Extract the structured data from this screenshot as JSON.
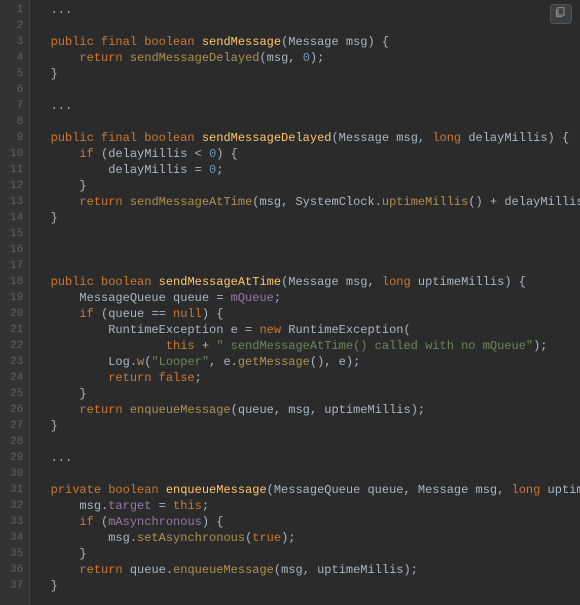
{
  "gutter": {
    "start": 1,
    "end": 37
  },
  "copy": {
    "title": "Copy"
  },
  "code": {
    "lines": [
      [
        {
          "t": "  ...",
          "c": "ident"
        }
      ],
      [],
      [
        {
          "t": "  ",
          "c": "ident"
        },
        {
          "t": "public final boolean ",
          "c": "kw"
        },
        {
          "t": "sendMessage",
          "c": "method-decl"
        },
        {
          "t": "(",
          "c": "punc"
        },
        {
          "t": "Message",
          "c": "type"
        },
        {
          "t": " msg) {",
          "c": "punc"
        }
      ],
      [
        {
          "t": "      ",
          "c": "ident"
        },
        {
          "t": "return ",
          "c": "kw"
        },
        {
          "t": "sendMessageDelayed",
          "c": "method-call"
        },
        {
          "t": "(msg, ",
          "c": "punc"
        },
        {
          "t": "0",
          "c": "num"
        },
        {
          "t": ");",
          "c": "punc"
        }
      ],
      [
        {
          "t": "  ",
          "c": "ident"
        },
        {
          "t": "}",
          "c": "punc"
        }
      ],
      [],
      [
        {
          "t": "  ...",
          "c": "ident"
        }
      ],
      [],
      [
        {
          "t": "  ",
          "c": "ident"
        },
        {
          "t": "public final boolean ",
          "c": "kw"
        },
        {
          "t": "sendMessageDelayed",
          "c": "method-decl"
        },
        {
          "t": "(",
          "c": "punc"
        },
        {
          "t": "Message",
          "c": "type"
        },
        {
          "t": " msg, ",
          "c": "punc"
        },
        {
          "t": "long ",
          "c": "kw"
        },
        {
          "t": "delayMillis) {",
          "c": "punc"
        }
      ],
      [
        {
          "t": "      ",
          "c": "ident"
        },
        {
          "t": "if ",
          "c": "kw"
        },
        {
          "t": "(delayMillis < ",
          "c": "punc"
        },
        {
          "t": "0",
          "c": "num"
        },
        {
          "t": ") {",
          "c": "punc"
        }
      ],
      [
        {
          "t": "          delayMillis = ",
          "c": "ident"
        },
        {
          "t": "0",
          "c": "num"
        },
        {
          "t": ";",
          "c": "punc"
        }
      ],
      [
        {
          "t": "      }",
          "c": "punc"
        }
      ],
      [
        {
          "t": "      ",
          "c": "ident"
        },
        {
          "t": "return ",
          "c": "kw"
        },
        {
          "t": "sendMessageAtTime",
          "c": "method-call"
        },
        {
          "t": "(msg, ",
          "c": "punc"
        },
        {
          "t": "SystemClock",
          "c": "type"
        },
        {
          "t": ".",
          "c": "punc"
        },
        {
          "t": "uptimeMillis",
          "c": "method-call"
        },
        {
          "t": "() + delayMillis);",
          "c": "punc"
        }
      ],
      [
        {
          "t": "  }",
          "c": "punc"
        }
      ],
      [],
      [],
      [],
      [
        {
          "t": "  ",
          "c": "ident"
        },
        {
          "t": "public boolean ",
          "c": "kw"
        },
        {
          "t": "sendMessageAtTime",
          "c": "method-decl"
        },
        {
          "t": "(",
          "c": "punc"
        },
        {
          "t": "Message",
          "c": "type"
        },
        {
          "t": " msg, ",
          "c": "punc"
        },
        {
          "t": "long ",
          "c": "kw"
        },
        {
          "t": "uptimeMillis) {",
          "c": "punc"
        }
      ],
      [
        {
          "t": "      ",
          "c": "ident"
        },
        {
          "t": "MessageQueue",
          "c": "type"
        },
        {
          "t": " queue = ",
          "c": "punc"
        },
        {
          "t": "mQueue",
          "c": "field"
        },
        {
          "t": ";",
          "c": "punc"
        }
      ],
      [
        {
          "t": "      ",
          "c": "ident"
        },
        {
          "t": "if ",
          "c": "kw"
        },
        {
          "t": "(queue == ",
          "c": "punc"
        },
        {
          "t": "null",
          "c": "kw"
        },
        {
          "t": ") {",
          "c": "punc"
        }
      ],
      [
        {
          "t": "          ",
          "c": "ident"
        },
        {
          "t": "RuntimeException",
          "c": "type"
        },
        {
          "t": " e = ",
          "c": "punc"
        },
        {
          "t": "new ",
          "c": "kw"
        },
        {
          "t": "RuntimeException",
          "c": "type"
        },
        {
          "t": "(",
          "c": "punc"
        }
      ],
      [
        {
          "t": "                  ",
          "c": "ident"
        },
        {
          "t": "this ",
          "c": "kw"
        },
        {
          "t": "+ ",
          "c": "punc"
        },
        {
          "t": "\" sendMessageAtTime() called with no mQueue\"",
          "c": "str"
        },
        {
          "t": ");",
          "c": "punc"
        }
      ],
      [
        {
          "t": "          ",
          "c": "ident"
        },
        {
          "t": "Log",
          "c": "type"
        },
        {
          "t": ".",
          "c": "punc"
        },
        {
          "t": "w",
          "c": "method-call"
        },
        {
          "t": "(",
          "c": "punc"
        },
        {
          "t": "\"Looper\"",
          "c": "str"
        },
        {
          "t": ", e.",
          "c": "punc"
        },
        {
          "t": "getMessage",
          "c": "method-call"
        },
        {
          "t": "(), e);",
          "c": "punc"
        }
      ],
      [
        {
          "t": "          ",
          "c": "ident"
        },
        {
          "t": "return false",
          "c": "kw"
        },
        {
          "t": ";",
          "c": "punc"
        }
      ],
      [
        {
          "t": "      }",
          "c": "punc"
        }
      ],
      [
        {
          "t": "      ",
          "c": "ident"
        },
        {
          "t": "return ",
          "c": "kw"
        },
        {
          "t": "enqueueMessage",
          "c": "method-call"
        },
        {
          "t": "(queue, msg, uptimeMillis);",
          "c": "punc"
        }
      ],
      [
        {
          "t": "  }",
          "c": "punc"
        }
      ],
      [],
      [
        {
          "t": "  ...",
          "c": "ident"
        }
      ],
      [],
      [
        {
          "t": "  ",
          "c": "ident"
        },
        {
          "t": "private boolean ",
          "c": "kw"
        },
        {
          "t": "enqueueMessage",
          "c": "method-decl"
        },
        {
          "t": "(",
          "c": "punc"
        },
        {
          "t": "MessageQueue",
          "c": "type"
        },
        {
          "t": " queue, ",
          "c": "punc"
        },
        {
          "t": "Message",
          "c": "type"
        },
        {
          "t": " msg, ",
          "c": "punc"
        },
        {
          "t": "long ",
          "c": "kw"
        },
        {
          "t": "uptimeMillis) {",
          "c": "punc"
        }
      ],
      [
        {
          "t": "      msg.",
          "c": "punc"
        },
        {
          "t": "target",
          "c": "field"
        },
        {
          "t": " = ",
          "c": "punc"
        },
        {
          "t": "this",
          "c": "kw"
        },
        {
          "t": ";",
          "c": "punc"
        }
      ],
      [
        {
          "t": "      ",
          "c": "ident"
        },
        {
          "t": "if ",
          "c": "kw"
        },
        {
          "t": "(",
          "c": "punc"
        },
        {
          "t": "mAsynchronous",
          "c": "field"
        },
        {
          "t": ") {",
          "c": "punc"
        }
      ],
      [
        {
          "t": "          msg.",
          "c": "punc"
        },
        {
          "t": "setAsynchronous",
          "c": "method-call"
        },
        {
          "t": "(",
          "c": "punc"
        },
        {
          "t": "true",
          "c": "kw"
        },
        {
          "t": ");",
          "c": "punc"
        }
      ],
      [
        {
          "t": "      }",
          "c": "punc"
        }
      ],
      [
        {
          "t": "      ",
          "c": "ident"
        },
        {
          "t": "return ",
          "c": "kw"
        },
        {
          "t": "queue.",
          "c": "punc"
        },
        {
          "t": "enqueueMessage",
          "c": "method-call"
        },
        {
          "t": "(msg, uptimeMillis);",
          "c": "punc"
        }
      ],
      [
        {
          "t": "  }",
          "c": "punc"
        }
      ]
    ]
  }
}
